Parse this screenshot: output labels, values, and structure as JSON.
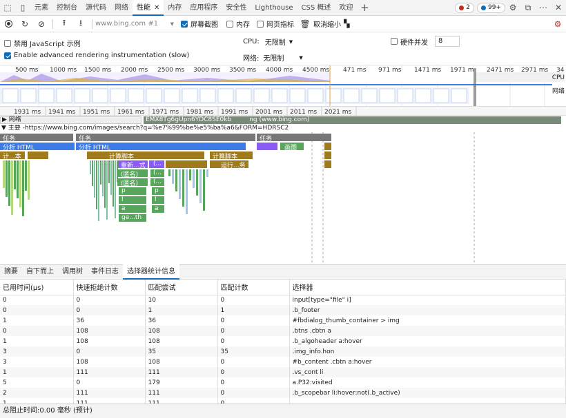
{
  "tabs": [
    {
      "label": "元素"
    },
    {
      "label": "控制台"
    },
    {
      "label": "源代码"
    },
    {
      "label": "网络"
    },
    {
      "label": "性能",
      "active": true
    },
    {
      "label": "内存"
    },
    {
      "label": "应用程序"
    },
    {
      "label": "安全性"
    },
    {
      "label": "Lighthouse"
    },
    {
      "label": "CSS 概述"
    },
    {
      "label": "欢迎"
    }
  ],
  "badges": {
    "errors": "2",
    "messages": "99+"
  },
  "toolbar": {
    "url": "www.bing.com #1",
    "screenshot": "屏幕截图",
    "memory": "内存",
    "web_vitals": "网页指标",
    "unminify": "取消缩小"
  },
  "settings": {
    "disable_js": "禁用 JavaScript 示例",
    "advanced_rendering": "Enable advanced rendering instrumentation (slow)",
    "cpu_label": "CPU:",
    "cpu_value": "无限制",
    "network_label": "网络:",
    "network_value": "无限制",
    "hardware_concurrency": "硬件并发",
    "hardware_value": "8"
  },
  "overview": {
    "ticks": [
      "500 ms",
      "1000 ms",
      "1500 ms",
      "2000 ms",
      "2500 ms",
      "3000 ms",
      "3500 ms",
      "4000 ms",
      "4500 ms",
      "471 ms",
      "971 ms",
      "1471 ms",
      "1971 m",
      "2471 ms",
      "2971 ms",
      "34"
    ],
    "cpu_label": "CPU",
    "net_label": "网络"
  },
  "ruler": {
    "ticks": [
      "1931 ms",
      "1941 ms",
      "1951 ms",
      "1961 ms",
      "1971 ms",
      "1981 ms",
      "1991 ms",
      "2001 ms",
      "2011 ms",
      "2021 ms"
    ]
  },
  "flame": {
    "network_track": "网络",
    "network_request": "EMX8Tg6gUpn6YDC8SE0kb",
    "network_request2": "ng (www.bing.com)",
    "main_track": "主要 -https://www.bing.com/images/search?q=%e7%99%be%e5%ba%a6&FORM=HDRSC2",
    "task": "任务",
    "parse_html": "分析 HTML",
    "compute": "计...本",
    "eval_script": "计算脚本",
    "recalc": "重新...式",
    "anon": "(匿名)",
    "paren": "(...",
    "p": "p",
    "l": "l",
    "a": "a",
    "geth": "ge...th",
    "run_task": "运行...务",
    "paint": "画图"
  },
  "bottom_tabs": [
    "摘要",
    "自下而上",
    "调用树",
    "事件日志",
    "选择器统计信息"
  ],
  "table": {
    "headers": [
      "已用时间(μs)",
      "快速拒绝计数",
      "匹配尝试",
      "匹配计数",
      "选择器"
    ],
    "rows": [
      [
        "0",
        "0",
        "10",
        "0",
        "input[type=\"file\" i]"
      ],
      [
        "0",
        "0",
        "1",
        "1",
        ".b_footer"
      ],
      [
        "1",
        "36",
        "36",
        "0",
        "#fbdialog_thumb_container > img"
      ],
      [
        "0",
        "108",
        "108",
        "0",
        ".btns .cbtn a"
      ],
      [
        "1",
        "108",
        "108",
        "0",
        ".b_algoheader a:hover"
      ],
      [
        "3",
        "0",
        "35",
        "35",
        ".img_info.hon"
      ],
      [
        "3",
        "108",
        "108",
        "0",
        "#b_content .cbtn a:hover"
      ],
      [
        "1",
        "111",
        "111",
        "0",
        ".vs_cont li"
      ],
      [
        "5",
        "0",
        "179",
        "0",
        "a.P32:visited"
      ],
      [
        "2",
        "111",
        "111",
        "0",
        ".b_scopebar li:hover:not(.b_active)"
      ],
      [
        "1",
        "111",
        "111",
        "0",
        ""
      ]
    ]
  },
  "status": "总阻止时间:0.00 毫秒 (预计)",
  "colors": {
    "accent": "#0f6cbd",
    "script": "#a07b1e",
    "parse": "#3d7ce6",
    "render": "#8a5cf5",
    "paint": "#58a55c"
  }
}
